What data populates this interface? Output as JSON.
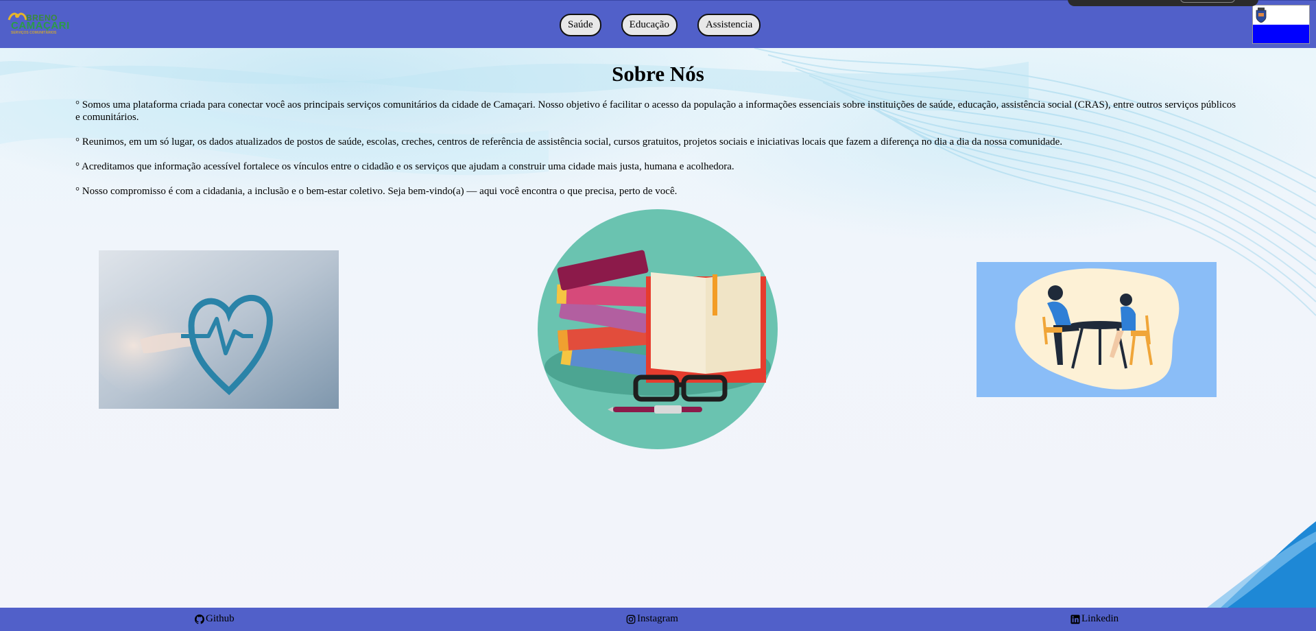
{
  "header": {
    "logo": {
      "line1": "BRENO",
      "line2": "CAMAÇARI",
      "line3": "SERVIÇOS COMUNITÁRIOS"
    },
    "nav": [
      {
        "label": "Saúde"
      },
      {
        "label": "Educação"
      },
      {
        "label": "Assistencia"
      }
    ],
    "flag_colors": {
      "top": "#ffffff",
      "bottom": "#0000ff"
    }
  },
  "main": {
    "title": "Sobre Nós",
    "paragraphs": [
      "° Somos uma plataforma criada para conectar você aos principais serviços comunitários da cidade de Camaçari. Nosso objetivo é facilitar o acesso da população a informações essenciais sobre instituições de saúde, educação, assistência social (CRAS), entre outros serviços públicos e comunitários.",
      "° Reunimos, em um só lugar, os dados atualizados de postos de saúde, escolas, creches, centros de referência de assistência social, cursos gratuitos, projetos sociais e iniciativas locais que fazem a diferença no dia a dia da nossa comunidade.",
      "° Acreditamos que informação acessível fortalece os vínculos entre o cidadão e os serviços que ajudam a construir uma cidade mais justa, humana e acolhedora.",
      "° Nosso compromisso é com a cidadania, a inclusão e o bem-estar coletivo. Seja bem-vindo(a) — aqui você encontra o que precisa, perto de você."
    ]
  },
  "footer": {
    "links": [
      {
        "label": "Github",
        "icon": "github-icon"
      },
      {
        "label": "Instagram",
        "icon": "instagram-icon"
      },
      {
        "label": "Linkedin",
        "icon": "linkedin-icon"
      }
    ]
  },
  "colors": {
    "bar": "#5160c9",
    "button_bg": "#e8e8e8"
  }
}
